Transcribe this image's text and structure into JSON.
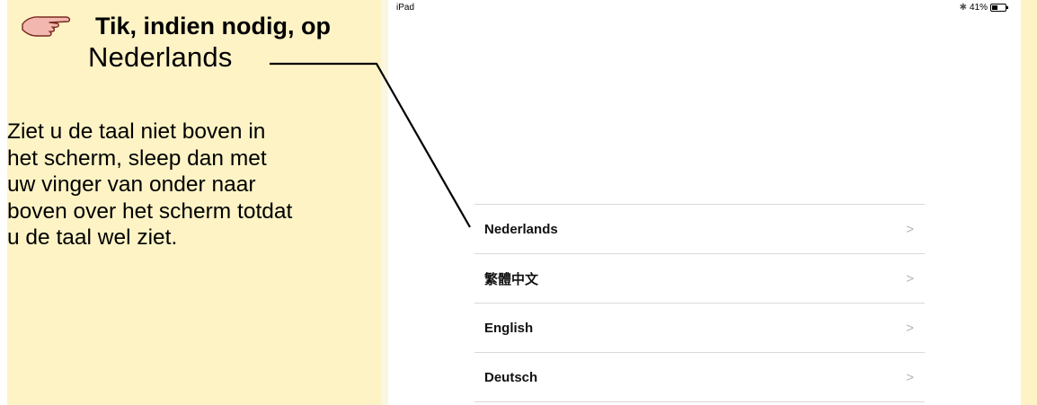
{
  "instruction": {
    "title": "Tik, indien nodig, op",
    "target": "Nederlands",
    "body_lines": [
      "Ziet u de taal niet boven in",
      "het scherm, sleep dan met",
      "uw vinger van onder naar",
      "boven over het scherm totdat",
      "u de taal wel ziet."
    ],
    "pointer_icon": "pointing-hand-icon"
  },
  "status_bar": {
    "device": "iPad",
    "battery": "41%",
    "bluetooth_icon": "bluetooth-icon",
    "battery_icon": "battery-icon"
  },
  "languages": [
    {
      "label": "Nederlands"
    },
    {
      "label": "繁體中文"
    },
    {
      "label": "English"
    },
    {
      "label": "Deutsch"
    }
  ],
  "colors": {
    "panel_background": "#fdf3c5",
    "separator": "#d9d9d9",
    "chevron": "#b5b5b5"
  }
}
